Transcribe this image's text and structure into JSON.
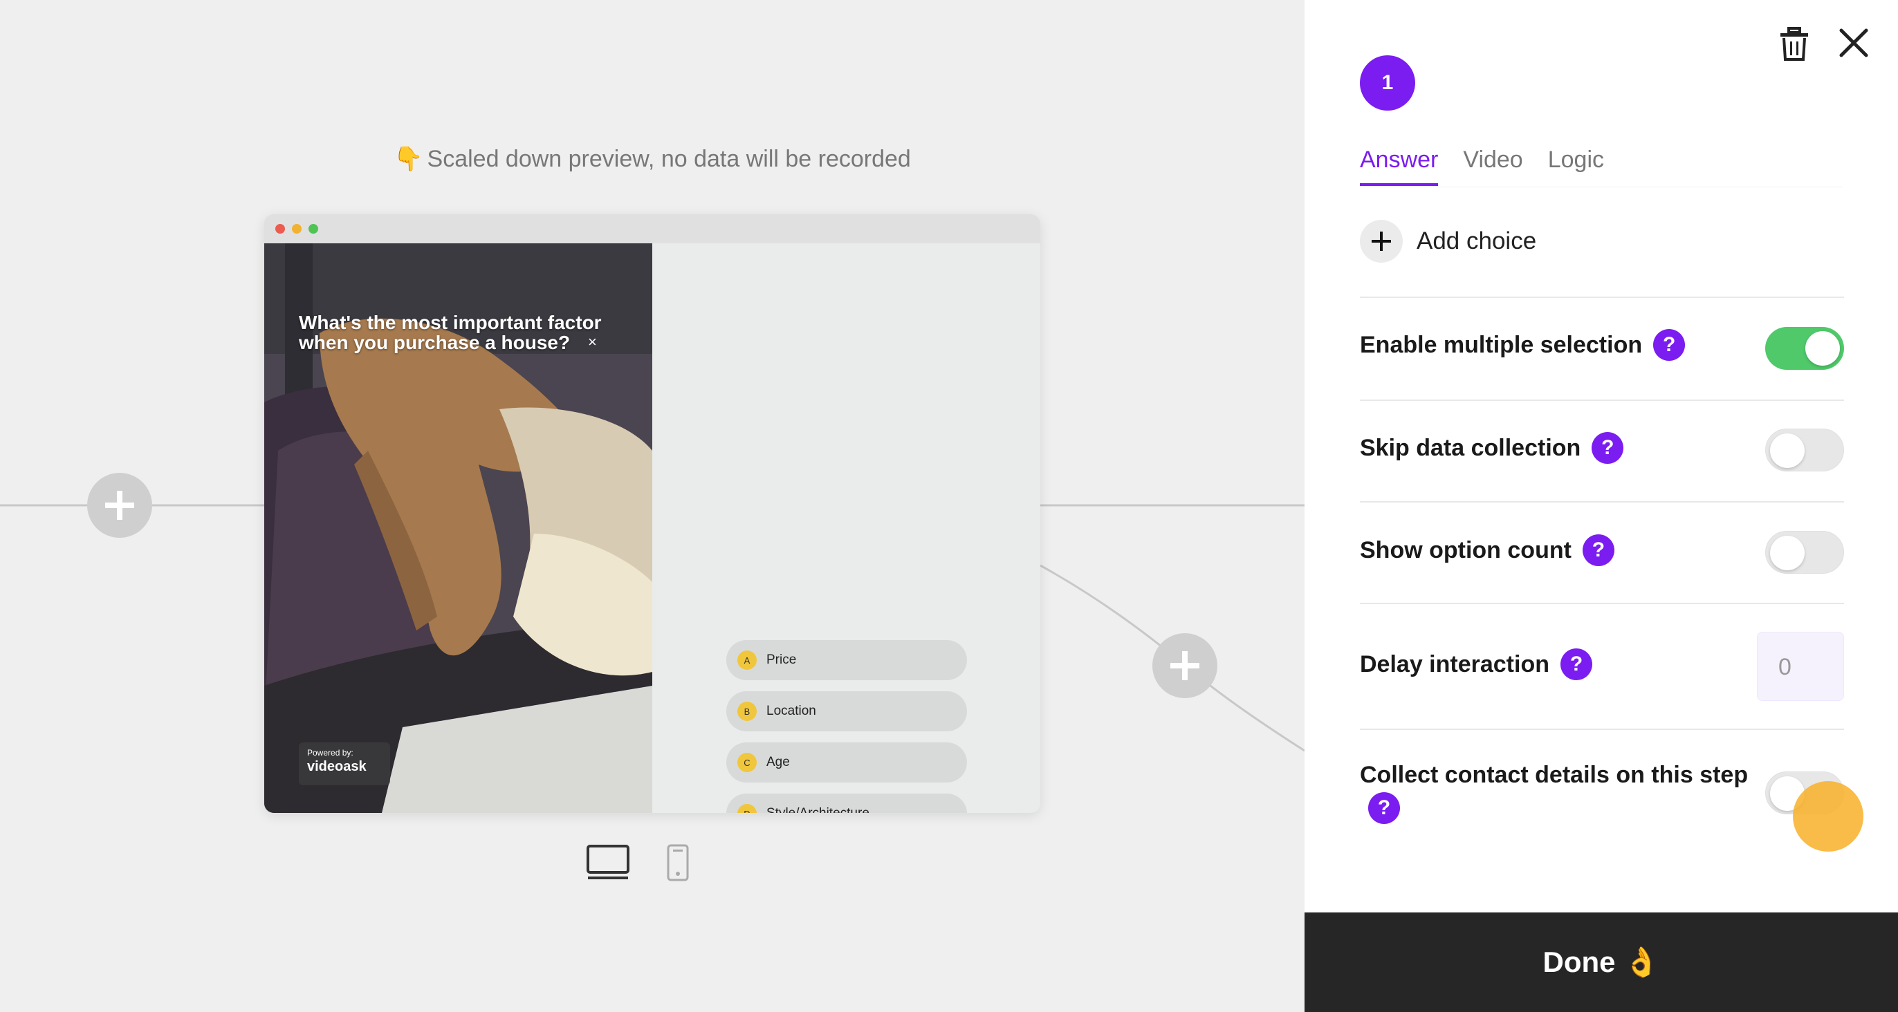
{
  "preview": {
    "note_emoji": "👇",
    "note": "Scaled down preview, no data will be recorded",
    "question": "What's the most important factor when you purchase a house?",
    "close_glyph": "×",
    "powered_by": "Powered by:",
    "brand": "videoask",
    "choices": [
      {
        "letter": "A",
        "label": "Price"
      },
      {
        "letter": "B",
        "label": "Location"
      },
      {
        "letter": "C",
        "label": "Age"
      },
      {
        "letter": "D",
        "label": "Style/Architecture"
      }
    ]
  },
  "devices": {
    "desktop_icon": "desktop-icon",
    "mobile_icon": "mobile-icon",
    "active": "desktop"
  },
  "panel": {
    "step_number": "1",
    "tabs": [
      {
        "label": "Answer",
        "active": true
      },
      {
        "label": "Video",
        "active": false
      },
      {
        "label": "Logic",
        "active": false
      }
    ],
    "add_choice": "Add choice",
    "settings": {
      "multiple": {
        "label": "Enable multiple selection",
        "enabled": true
      },
      "skip": {
        "label": "Skip data collection",
        "enabled": false
      },
      "count": {
        "label": "Show option count",
        "enabled": false
      },
      "delay": {
        "label": "Delay interaction",
        "value": "0"
      },
      "contact": {
        "label": "Collect contact details on this step",
        "enabled": false
      }
    },
    "help_glyph": "?",
    "done": "Done 👌"
  },
  "colors": {
    "accent": "#7b1cf0",
    "toggle_on": "#4fc96a",
    "done_bg": "#262626"
  }
}
